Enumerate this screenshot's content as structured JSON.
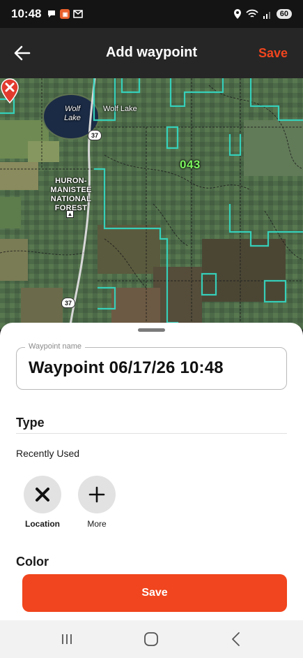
{
  "status_bar": {
    "time": "10:48",
    "battery": "60"
  },
  "header": {
    "title": "Add waypoint",
    "save_label": "Save"
  },
  "map": {
    "lake_label": "Wolf Lake",
    "town_label": "Wolf Lake",
    "forest_label": "HURON-MANISTEE NATIONAL FOREST",
    "unit_label": "043",
    "route_shield_top": "37",
    "route_shield_bottom": "37"
  },
  "waypoint_name": {
    "legend": "Waypoint name",
    "value": "Waypoint 06/17/26 10:48"
  },
  "type_section": {
    "heading": "Type",
    "recent_label": "Recently Used",
    "options": [
      {
        "label": "Location",
        "icon": "x-mark-icon"
      },
      {
        "label": "More",
        "icon": "plus-icon"
      }
    ]
  },
  "color_section": {
    "heading": "Color"
  },
  "save_button": {
    "label": "Save"
  },
  "colors": {
    "accent": "#f0451e",
    "header_bg": "#262626",
    "unit_label": "#7cf55f",
    "boundary": "#35d6c0"
  }
}
